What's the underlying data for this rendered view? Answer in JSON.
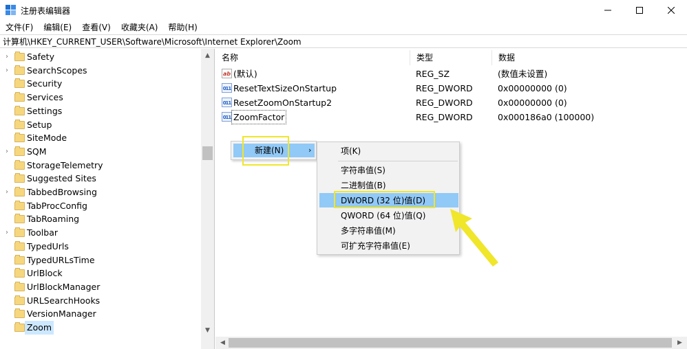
{
  "window": {
    "title": "注册表编辑器"
  },
  "menu": [
    "文件(F)",
    "编辑(E)",
    "查看(V)",
    "收藏夹(A)",
    "帮助(H)"
  ],
  "address": "计算机\\HKEY_CURRENT_USER\\Software\\Microsoft\\Internet Explorer\\Zoom",
  "tree": [
    {
      "label": "Safety",
      "expandable": true
    },
    {
      "label": "SearchScopes",
      "expandable": true
    },
    {
      "label": "Security",
      "expandable": false
    },
    {
      "label": "Services",
      "expandable": false
    },
    {
      "label": "Settings",
      "expandable": false
    },
    {
      "label": "Setup",
      "expandable": false
    },
    {
      "label": "SiteMode",
      "expandable": false
    },
    {
      "label": "SQM",
      "expandable": true
    },
    {
      "label": "StorageTelemetry",
      "expandable": false
    },
    {
      "label": "Suggested Sites",
      "expandable": false
    },
    {
      "label": "TabbedBrowsing",
      "expandable": true
    },
    {
      "label": "TabProcConfig",
      "expandable": false
    },
    {
      "label": "TabRoaming",
      "expandable": false
    },
    {
      "label": "Toolbar",
      "expandable": true
    },
    {
      "label": "TypedUrls",
      "expandable": false
    },
    {
      "label": "TypedURLsTime",
      "expandable": false
    },
    {
      "label": "UrlBlock",
      "expandable": false
    },
    {
      "label": "UrlBlockManager",
      "expandable": false
    },
    {
      "label": "URLSearchHooks",
      "expandable": false
    },
    {
      "label": "VersionManager",
      "expandable": false
    },
    {
      "label": "Zoom",
      "expandable": false,
      "selected": true
    }
  ],
  "columns": {
    "name": "名称",
    "type": "类型",
    "data": "数据"
  },
  "values": [
    {
      "name": "(默认)",
      "type": "REG_SZ",
      "data": "(数值未设置)",
      "icon": "ab"
    },
    {
      "name": "ResetTextSizeOnStartup",
      "type": "REG_DWORD",
      "data": "0x00000000 (0)",
      "icon": "bin"
    },
    {
      "name": "ResetZoomOnStartup2",
      "type": "REG_DWORD",
      "data": "0x00000000 (0)",
      "icon": "bin"
    },
    {
      "name": "ZoomFactor",
      "type": "REG_DWORD",
      "data": "0x000186a0 (100000)",
      "icon": "bin",
      "focused": true
    }
  ],
  "context_menu": {
    "new_label": "新建(N)",
    "submenu_arrow": "›"
  },
  "submenu": {
    "key": "项(K)",
    "items": [
      "字符串值(S)",
      "二进制值(B)",
      "DWORD (32 位)值(D)",
      "QWORD (64 位)值(Q)",
      "多字符串值(M)",
      "可扩充字符串值(E)"
    ],
    "highlighted_index": 2
  },
  "icons": {
    "ab": "ab",
    "bin": "011"
  },
  "colors": {
    "highlight": "#91c9f7",
    "annotation": "#f0e62a",
    "folder": "#f6d77e"
  }
}
